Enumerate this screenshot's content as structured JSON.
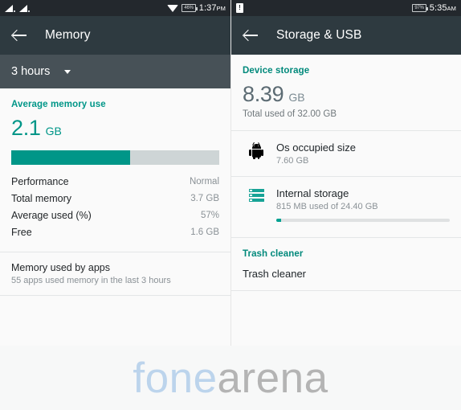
{
  "left_panel": {
    "status_bar": {
      "signal_icon_1": "signal-bars-icon",
      "signal_icon_2": "signal-bars-icon",
      "wifi_icon": "wifi-icon",
      "battery_level": "46%",
      "time": "1:37",
      "ampm": "PM"
    },
    "app_bar": {
      "back_icon": "back-arrow-icon",
      "title": "Memory"
    },
    "spinner": {
      "label": "3 hours",
      "caret_icon": "chevron-down-icon"
    },
    "section_title": "Average memory use",
    "average_memory": {
      "value": "2.1",
      "unit": "GB",
      "percent_used": 57
    },
    "stats": [
      {
        "label": "Performance",
        "value": "Normal"
      },
      {
        "label": "Total memory",
        "value": "3.7 GB"
      },
      {
        "label": "Average used (%)",
        "value": "57%"
      },
      {
        "label": "Free",
        "value": "1.6 GB"
      }
    ],
    "apps_item": {
      "title": "Memory used by apps",
      "subtitle": "55 apps used memory in the last 3 hours"
    }
  },
  "right_panel": {
    "status_bar": {
      "sim_icon": "sim-card-alert-icon",
      "battery_level": "97%",
      "time": "5:35",
      "ampm": "AM"
    },
    "app_bar": {
      "back_icon": "back-arrow-icon",
      "title": "Storage & USB"
    },
    "section_title": "Device storage",
    "device_storage": {
      "value": "8.39",
      "unit": "GB",
      "subtitle": "Total used of 32.00 GB"
    },
    "rows": [
      {
        "icon": "android-robot-icon",
        "title": "Os occupied size",
        "subtitle": "7.60 GB",
        "has_bar": false,
        "percent": 0
      },
      {
        "icon": "storage-stack-icon",
        "title": "Internal storage",
        "subtitle": "815 MB used of 24.40 GB",
        "has_bar": true,
        "percent": 3
      }
    ],
    "trash_section_title": "Trash cleaner",
    "trash_item_label": "Trash cleaner"
  },
  "watermark": {
    "part1": "fone",
    "part2": "arena"
  },
  "colors": {
    "teal": "#009688",
    "status_bar_bg": "#23282d",
    "app_bar_bg": "#2e3a40",
    "spinner_bg": "#475157",
    "content_bg": "#fafafa",
    "watermark_blue": "#bcd4ec",
    "watermark_gray": "#b4b4b4"
  }
}
